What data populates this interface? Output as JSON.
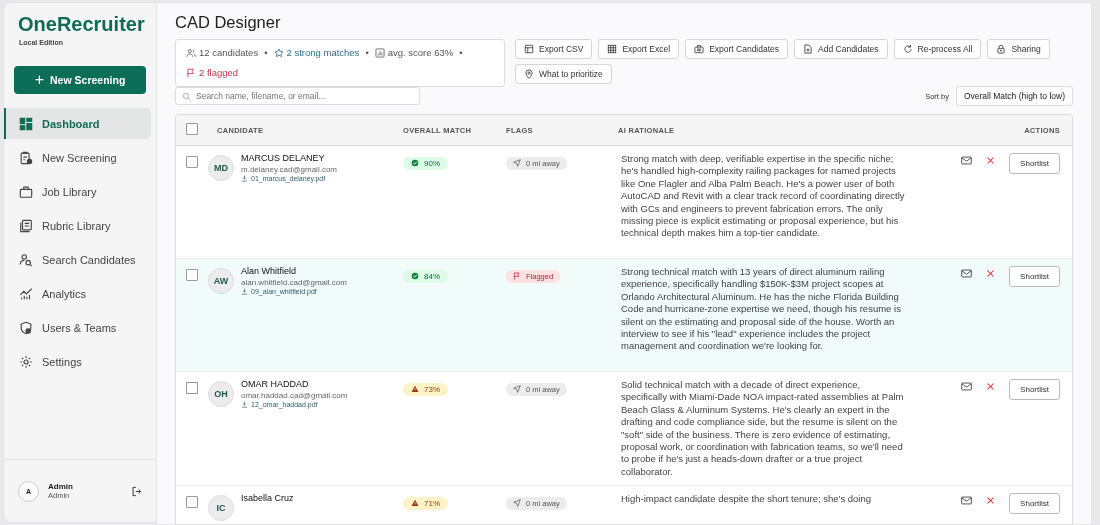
{
  "brand": {
    "name": "OneRecruiter",
    "edition": "Local Edition"
  },
  "new_button": {
    "icon": "+",
    "label": "New Screening"
  },
  "sidebar": {
    "items": [
      {
        "label": "Dashboard",
        "selected": true
      },
      {
        "label": "New Screening",
        "selected": false
      },
      {
        "label": "Job Library",
        "selected": false
      },
      {
        "label": "Rubric Library",
        "selected": false
      },
      {
        "label": "Search Candidates",
        "selected": false
      },
      {
        "label": "Analytics",
        "selected": false
      },
      {
        "label": "Users & Teams",
        "selected": false
      },
      {
        "label": "Settings",
        "selected": false
      }
    ]
  },
  "user": {
    "initial": "A",
    "name": "Admin",
    "role": "Admin"
  },
  "page_title": "CAD Designer",
  "stats": [
    {
      "text": "12 candidates",
      "separator": "•"
    },
    {
      "text": "2 strong matches",
      "separator": "•"
    },
    {
      "text": "avg. score 63%",
      "separator": "•"
    },
    {
      "text": "2 flagged"
    }
  ],
  "actions": [
    {
      "label": "Export CSV"
    },
    {
      "label": "Export Excel"
    },
    {
      "label": "Export Candidates"
    },
    {
      "label": "Add Candidates"
    },
    {
      "label": "Re-process All"
    },
    {
      "label": "Sharing"
    },
    {
      "label": "What to prioritize"
    }
  ],
  "search": {
    "placeholder": "Search name, filename, or email..."
  },
  "sort": {
    "label": "Sort by",
    "value": "Overall Match (high to low)"
  },
  "table": {
    "all_checked": false,
    "columns": [
      "CANDIDATE",
      "OVERALL MATCH",
      "FLAGS",
      "AI RATIONALE",
      "ACTIONS"
    ],
    "rows": [
      {
        "selected": false,
        "checked": false,
        "initials": "MD",
        "name": "MARCUS DELANEY",
        "email": "m.delaney.cad@gmail.com",
        "file": "01_marcus_delaney.pdf",
        "match": {
          "text": "90%",
          "kind": "good"
        },
        "flag": {
          "text": "0 mi away",
          "kind": "distance"
        },
        "rationale": "Strong match with deep, verifiable expertise in the specific niche; he's handled high-complexity railing packages for named projects like One Flagler and Alba Palm Beach. He's a power user of both AutoCAD and Revit with a clear track record of coordinating directly with GCs and engineers to prevent fabrication errors. The only missing piece is explicit estimating or proposal experience, but his technical depth makes him a top-tier candidate.",
        "action": "Shortlist"
      },
      {
        "selected": true,
        "checked": false,
        "initials": "AW",
        "name": "Alan Whitfield",
        "email": "alan.whitfield.cad@gmail.com",
        "file": "09_alan_whitfield.pdf",
        "match": {
          "text": "84%",
          "kind": "good"
        },
        "flag": {
          "text": "Flagged",
          "kind": "flagged"
        },
        "rationale": "Strong technical match with 13 years of direct aluminum railing experience, specifically handling $150K-$3M project scopes at Orlando Architectural Aluminum. He has the niche Florida Building Code and hurricane-zone expertise we need, though his resume is silent on the estimating and proposal side of the house. Worth an interview to see if his \"lead\" experience includes the project management and coordination we're looking for.",
        "action": "Shortlist"
      },
      {
        "selected": false,
        "checked": false,
        "initials": "OH",
        "name": "OMAR HADDAD",
        "email": "omar.haddad.cad@gmail.com",
        "file": "12_omar_haddad.pdf",
        "match": {
          "text": "73%",
          "kind": "warn"
        },
        "flag": {
          "text": "0 mi away",
          "kind": "distance"
        },
        "rationale": "Solid technical match with a decade of direct experience, specifically with Miami-Dade NOA impact-rated assemblies at Palm Beach Glass & Aluminum Systems. He's clearly an expert in the drafting and code compliance side, but the resume is silent on the \"soft\" side of the business. There is zero evidence of estimating, proposal work, or coordination with fabrication teams, so we'll need to probe if he's just a heads-down drafter or a true project collaborator.",
        "action": "Shortlist"
      },
      {
        "selected": false,
        "checked": false,
        "initials": "IC",
        "name": "Isabella Cruz",
        "match": {
          "text": "71%",
          "kind": "warn"
        },
        "flag": {
          "text": "0 mi away",
          "kind": "distance"
        },
        "rationale": "High-impact candidate despite the short tenure; she's doing",
        "action": "Shortlist"
      }
    ]
  }
}
